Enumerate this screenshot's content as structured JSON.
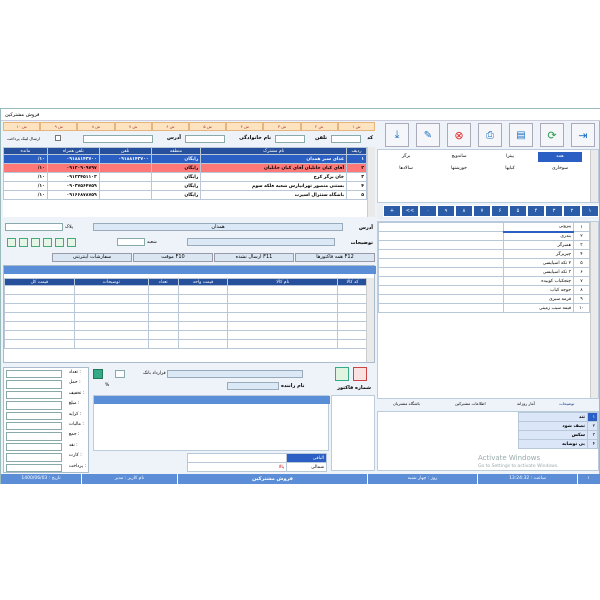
{
  "window": {
    "title": "فروش مشترکین"
  },
  "tabs": [
    "۱ ش",
    "۲ ش",
    "۳ ش",
    "۴ ش",
    "۵ ش",
    "۶ ش",
    "۷ ش",
    "۸ ش",
    "۹ ش",
    "۱۰ ش"
  ],
  "header": {
    "code_label": "کد",
    "phone_label": "تلفن",
    "name_label": "نام خانوادگی",
    "address_label": "آدرس",
    "online_label": "ارسال لینک پرداخت"
  },
  "customers": {
    "columns": [
      "ردیف",
      "نام مشترک",
      "منطقه",
      "تلفن",
      "تلفن همراه",
      "مانده"
    ],
    "rows": [
      {
        "idx": "۱",
        "name": "غذای سبز همدان",
        "area": "رایگان",
        "phone": "۰۹۱۸۸۱۴۳۷۰۰",
        "mobile": "۰۹۱۸۸۱۴۳۷۰۰",
        "bal": "۱۰/"
      },
      {
        "idx": "۲",
        "name": "آقای کیان خانلیان آقای کیان خانلیان",
        "area": "رایگان",
        "phone": "",
        "mobile": "۰۹۱۲۰۹۰۹۷۹۷",
        "bal": "۱۰/"
      },
      {
        "idx": "۳",
        "name": "خان برگر کرج",
        "area": "رایگان",
        "phone": "",
        "mobile": "۰۹۱۲۲۴۵۱۱۰۳",
        "bal": "۱۰/"
      },
      {
        "idx": "۴",
        "name": "بستنی منصور تهرانپارس شعبه فلکه سوم",
        "area": "رایگان",
        "phone": "",
        "mobile": "۰۹۰۳۷۵۶۴۷۵۹",
        "bal": "۱۰/"
      },
      {
        "idx": "۵",
        "name": "باشگاه ستثرال اسپرت",
        "area": "رایگان",
        "phone": "",
        "mobile": "۰۹۱۶۶۸۷۸۷۵۹",
        "bal": "۱۰/"
      }
    ]
  },
  "address": {
    "label": "آدرس",
    "value": "همدان",
    "desc_label": "توضیحات",
    "plaque_label": "پلاک",
    "unit_label": "شعبه"
  },
  "invoice_tabs": [
    "همه فاکتورها",
    "ارسال نشده F11",
    "موقت F10",
    "سفارشات اینترنتی"
  ],
  "invoice_tab_keys": [
    "F12",
    "F11",
    "F10"
  ],
  "invoice_grid": {
    "columns": [
      "کد کالا",
      "نام کالا",
      "قیمت واحد",
      "تعداد",
      "توضیحات",
      "قیمت کل"
    ]
  },
  "left_fields": [
    "تعداد :",
    "حمل :",
    "تخفیف :",
    "مبلغ :",
    "کرایه :",
    "مالیات :",
    "جمع :",
    "نقد :",
    "کارت :",
    "پرداخت :"
  ],
  "bottom": {
    "invoice_number_label": "شماره فاکتور",
    "driver_label": "نام راننده",
    "bank_label": "قرارداد بانک",
    "percent_label": "%"
  },
  "pay_grid": {
    "rows": [
      [
        "",
        "الباقی"
      ],
      [
        "پالا",
        "شمالی"
      ],
      [
        "",
        "الحاقی"
      ]
    ]
  },
  "toolbar": [
    "exit-icon",
    "refresh-icon",
    "receipt-icon",
    "printer-icon",
    "cancel-icon",
    "edit-icon",
    "save-icon"
  ],
  "categories": {
    "row1": [
      "همه",
      "پیتزا",
      "ساندویچ",
      "برگر"
    ],
    "row2": [
      "سوخاری",
      "کبابها",
      "خورشتها",
      "سالادها"
    ]
  },
  "numpad": [
    "۱",
    "۲",
    "۳",
    "۴",
    "۵",
    "۶",
    "۷",
    "۸",
    "۹",
    "۰",
    "<<",
    "+",
    "-"
  ],
  "products": [
    {
      "no": "۱",
      "name": "پپرونی"
    },
    {
      "no": "۲",
      "name": "بندری"
    },
    {
      "no": "۳",
      "name": "همبرگر"
    },
    {
      "no": "۴",
      "name": "چیزبرگر"
    },
    {
      "no": "۵",
      "name": "۲ تکه اسپایسی"
    },
    {
      "no": "۶",
      "name": "۳ تکه اسپایسی"
    },
    {
      "no": "۷",
      "name": "چنجکباب کوبیده"
    },
    {
      "no": "۸",
      "name": "جوجه کباب"
    },
    {
      "no": "۹",
      "name": "قرمه سبزی"
    },
    {
      "no": "۱۰",
      "name": "قیمه سیب زمینی"
    }
  ],
  "notes_tabs": [
    "توضیحات",
    "آمار روزانه",
    "اطلاعات مشترکین",
    "باشگاه مشتریان"
  ],
  "notes": [
    {
      "no": "۱",
      "text": "تند"
    },
    {
      "no": "۲",
      "text": "نصف شود"
    },
    {
      "no": "۳",
      "text": "سکس"
    },
    {
      "no": "۴",
      "text": "بی نوشابه"
    }
  ],
  "watermark": {
    "title": "Activate Windows",
    "sub": "Go to Settings to activate Windows."
  },
  "status": {
    "date_label": "تاریخ :",
    "date": "1400/06/03",
    "user_label": "نام کاربر :",
    "user": "مدیر",
    "center": "فروش مشترکین",
    "day_label": "روز :",
    "day": "چهار شنبه",
    "time_label": "ساعت :",
    "time": "13:24:32",
    "page": "۱"
  },
  "colors": {
    "selected": "#2b5fc4",
    "alert": "#ff7878",
    "header": "#26509b",
    "tab": "#fde3c0"
  }
}
